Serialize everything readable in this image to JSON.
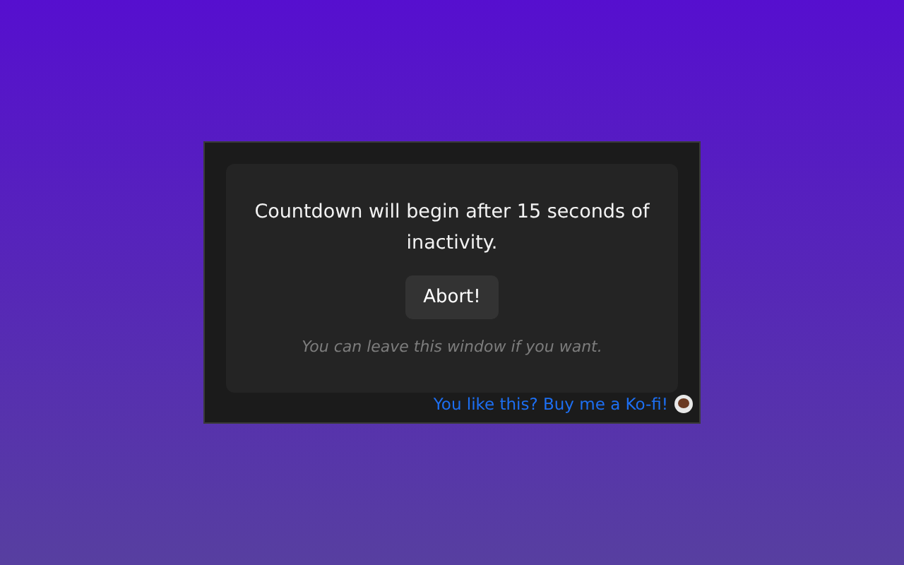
{
  "message": "Countdown will begin after 15 seconds of inactivity.",
  "button": "Abort!",
  "hint": "You can leave this window if you want.",
  "footer_link": "You like this? Buy me a Ko-fi!"
}
